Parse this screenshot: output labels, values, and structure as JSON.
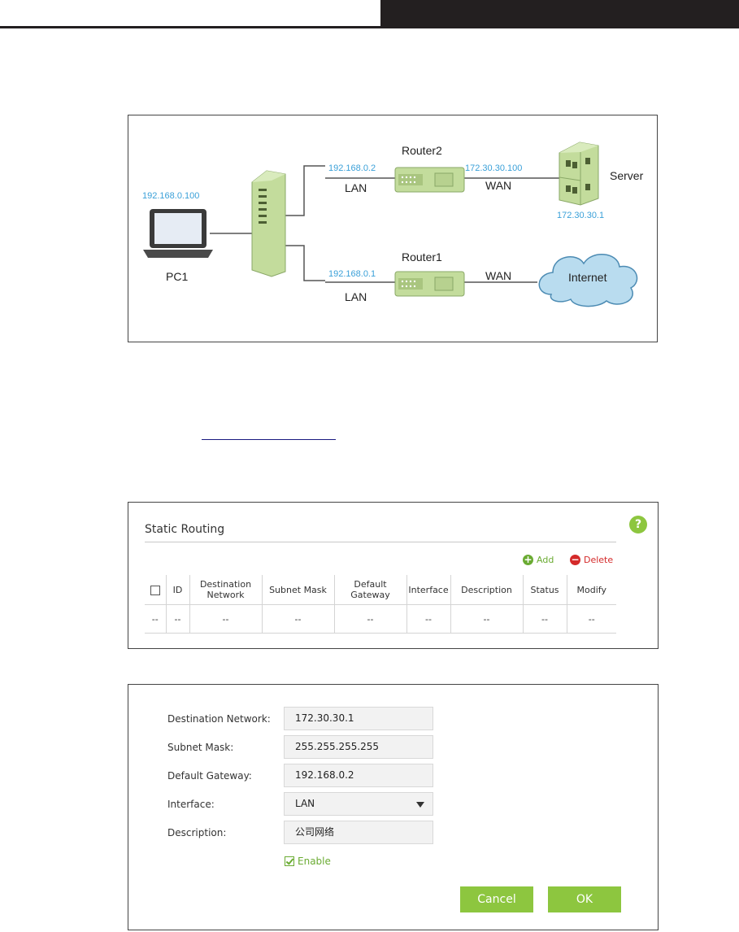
{
  "colors": {
    "accent_green": "#8dc63f",
    "link_green": "#6aab32",
    "delete_red": "#d42a2a",
    "ip_blue": "#3aa0d8",
    "device_green": "#c3dc9c"
  },
  "diagram": {
    "router2_name": "Router2",
    "router2_lan_ip": "192.168.0.2",
    "router2_lan_label": "LAN",
    "router2_wan_ip": "172.30.30.100",
    "router2_wan_label": "WAN",
    "server_label": "Server",
    "server_ip": "172.30.30.1",
    "pc_ip": "192.168.0.100",
    "pc_label": "PC1",
    "router1_name": "Router1",
    "router1_lan_ip": "192.168.0.1",
    "router1_lan_label": "LAN",
    "router1_wan_label": "WAN",
    "internet_label": "Internet",
    "icons": [
      "laptop-icon",
      "switch-icon",
      "router-icon",
      "server-icon",
      "cloud-icon"
    ]
  },
  "routing": {
    "title": "Static Routing",
    "help_label": "?",
    "add_label": "Add",
    "delete_label": "Delete",
    "columns": [
      "ID",
      "Destination Network",
      "Subnet Mask",
      "Default Gateway",
      "Interface",
      "Description",
      "Status",
      "Modify"
    ],
    "empty_row": [
      "--",
      "--",
      "--",
      "--",
      "--",
      "--",
      "--",
      "--",
      "--"
    ]
  },
  "form": {
    "dest_label": "Destination Network:",
    "dest_value": "172.30.30.1",
    "mask_label": "Subnet Mask:",
    "mask_value": "255.255.255.255",
    "gateway_label": "Default Gateway:",
    "gateway_value": "192.168.0.2",
    "interface_label": "Interface:",
    "interface_value": "LAN",
    "description_label": "Description:",
    "description_value": "公司网络",
    "enable_label": "Enable",
    "enable_checked": true,
    "cancel_label": "Cancel",
    "ok_label": "OK"
  }
}
